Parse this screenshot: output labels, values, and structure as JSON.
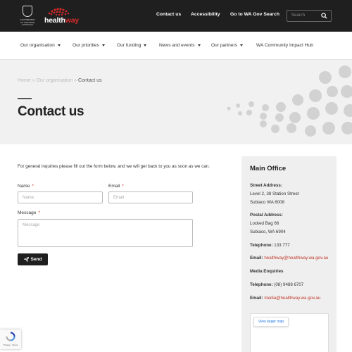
{
  "header": {
    "crest_text": "GOVERNMENT OF WESTERN AUSTRALIA",
    "logo_prefix": "health",
    "logo_suffix": "way",
    "nav": [
      "Contact us",
      "Accessibility",
      "Go to WA Gov Search"
    ],
    "search_placeholder": "Search"
  },
  "mainnav": {
    "items": [
      {
        "label": "Our organisation",
        "dropdown": true
      },
      {
        "label": "Our priorities",
        "dropdown": true
      },
      {
        "label": "Our funding",
        "dropdown": true
      },
      {
        "label": "News and events",
        "dropdown": true
      },
      {
        "label": "Our partners",
        "dropdown": true
      },
      {
        "label": "WA Community Impact Hub",
        "dropdown": false
      }
    ]
  },
  "hero": {
    "breadcrumb": {
      "home": "Home",
      "sep": " » ",
      "parent": "Our organisation",
      "current": "Contact us"
    },
    "title": "Contact us"
  },
  "form": {
    "intro": "For general inquiries please fill out the form below, and we will get back to you as soon as we can.",
    "name_label": "Name",
    "name_placeholder": "Name",
    "email_label": "Email",
    "email_placeholder": "Email",
    "message_label": "Message",
    "message_placeholder": "Message",
    "required_mark": "*",
    "send_label": "Send"
  },
  "sidebar": {
    "title": "Main Office",
    "street_heading": "Street Address:",
    "street_line1": "Level 2, 38 Station Street",
    "street_line2": "Subiaco WA 6008",
    "postal_heading": "Postal Address:",
    "postal_line1": "Locked Bag 66",
    "postal_line2": "Subiaco, WA 6904",
    "telephone_label": "Telephone:",
    "telephone": "133 777",
    "email_label": "Email:",
    "email": "healthway@healthway.wa.gov.au",
    "media_heading": "Media Enquiries",
    "media_telephone_label": "Telephone:",
    "media_telephone": "(08) 9488 6707",
    "media_email_label": "Email:",
    "media_email": "media@healthway.wa.gov.au",
    "map_button": "View larger map"
  },
  "recaptcha": {
    "text": "Privacy - Terms"
  },
  "colors": {
    "topbar": "#1f1f1f",
    "accent": "#d42a2a",
    "hero_bg": "#f1f1f1",
    "sidebar_bg": "#efefef"
  }
}
